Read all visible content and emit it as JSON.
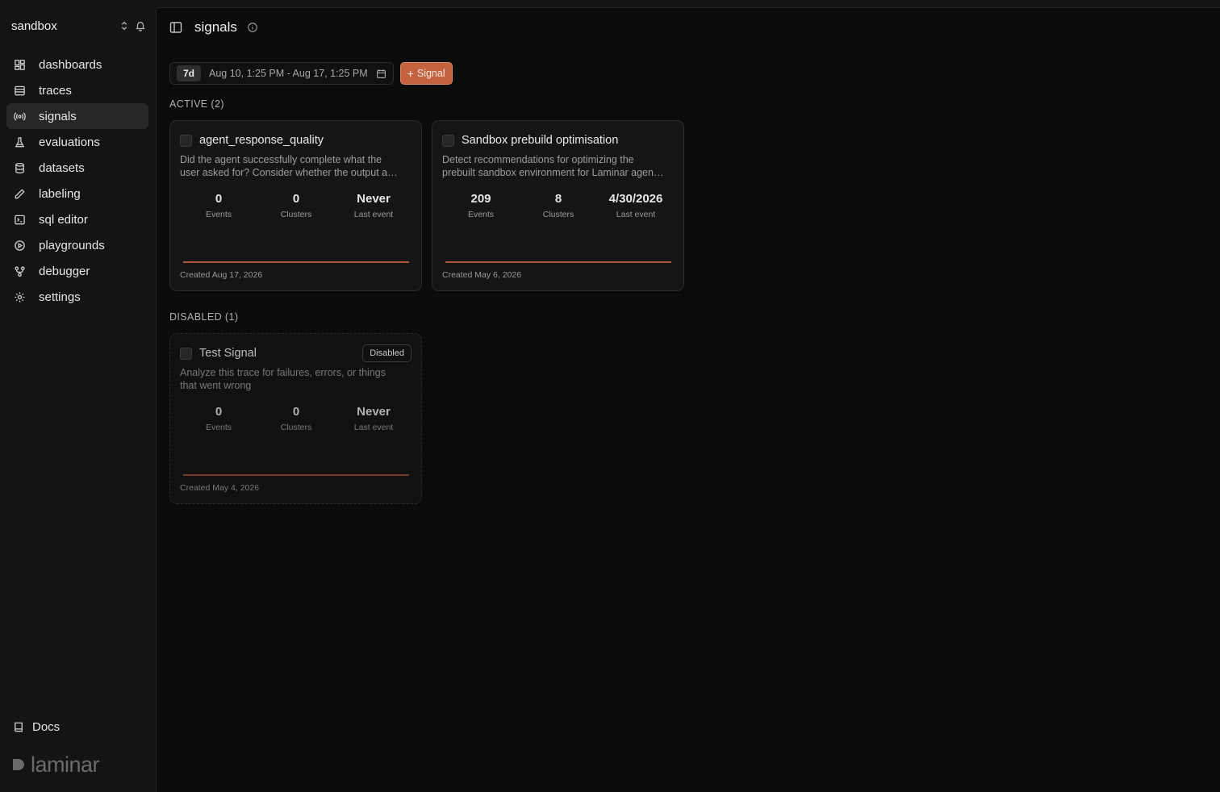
{
  "sidebar": {
    "project": "sandbox",
    "nav": [
      {
        "label": "dashboards",
        "icon": "dashboard-icon"
      },
      {
        "label": "traces",
        "icon": "traces-icon"
      },
      {
        "label": "signals",
        "icon": "signal-icon",
        "active": true
      },
      {
        "label": "evaluations",
        "icon": "flask-icon"
      },
      {
        "label": "datasets",
        "icon": "database-icon"
      },
      {
        "label": "labeling",
        "icon": "pencil-icon"
      },
      {
        "label": "sql editor",
        "icon": "terminal-icon"
      },
      {
        "label": "playgrounds",
        "icon": "play-icon"
      },
      {
        "label": "debugger",
        "icon": "debugger-icon"
      },
      {
        "label": "settings",
        "icon": "gear-icon"
      }
    ],
    "docs": "Docs",
    "brand": "laminar"
  },
  "header": {
    "title": "signals"
  },
  "toolbar": {
    "preset": "7d",
    "range": "Aug 10, 1:25 PM - Aug 17, 1:25 PM",
    "add_label": "Signal"
  },
  "sections": {
    "active": "ACTIVE (2)",
    "disabled": "DISABLED (1)"
  },
  "cards": [
    {
      "title": "agent_response_quality",
      "desc1": "Did the agent successfully complete what the",
      "desc2": "user asked for? Consider whether the output and the final state of the task",
      "events": "0",
      "events_label": "Events",
      "clusters": "0",
      "clusters_label": "Clusters",
      "last": "Never",
      "last_label": "Last event",
      "created": "Created Aug 17, 2026"
    },
    {
      "title": "Sandbox prebuild optimisation",
      "desc1": "Detect recommendations for optimizing the",
      "desc2": "prebuilt sandbox environment for Laminar agents and their tooling",
      "events": "209",
      "events_label": "Events",
      "clusters": "8",
      "clusters_label": "Clusters",
      "last": "4/30/2026",
      "last_label": "Last event",
      "created": "Created May 6, 2026"
    },
    {
      "title": "Test Signal",
      "badge": "Disabled",
      "desc1": "Analyze this trace for failures, errors, or things",
      "desc2": "that went wrong",
      "events": "0",
      "events_label": "Events",
      "clusters": "0",
      "clusters_label": "Clusters",
      "last": "Never",
      "last_label": "Last event",
      "created": "Created May 4, 2026"
    }
  ],
  "colors": {
    "accent": "#c4613f",
    "sparkline": "#b0583a"
  }
}
